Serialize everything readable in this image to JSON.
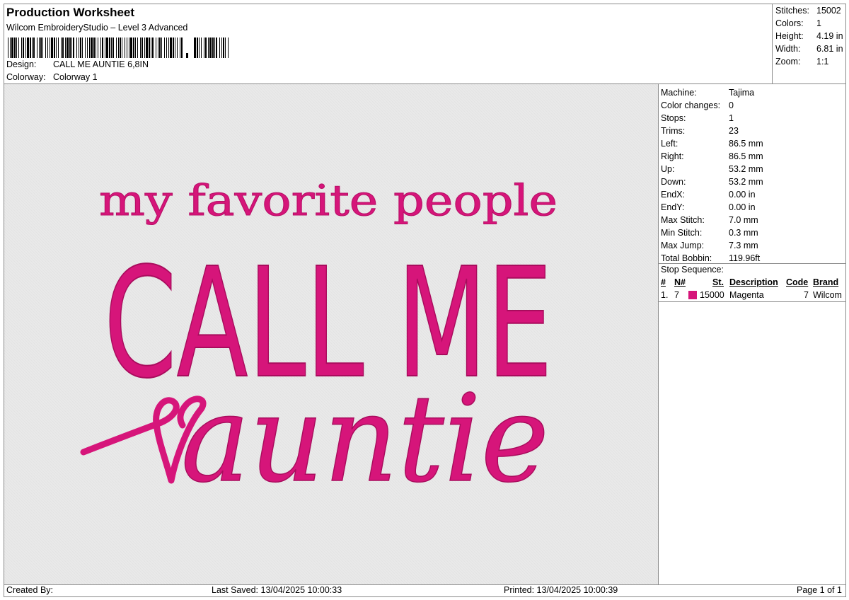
{
  "header": {
    "title": "Production Worksheet",
    "software": "Wilcom EmbroideryStudio – Level 3 Advanced",
    "design_label": "Design:",
    "design_value": "CALL ME AUNTIE 6,8IN",
    "colorway_label": "Colorway:",
    "colorway_value": "Colorway 1"
  },
  "summary": [
    {
      "label": "Stitches:",
      "value": "15002"
    },
    {
      "label": "Colors:",
      "value": "1"
    },
    {
      "label": "Height:",
      "value": "4.19 in"
    },
    {
      "label": "Width:",
      "value": "6.81 in"
    },
    {
      "label": "Zoom:",
      "value": "1:1"
    }
  ],
  "machine": [
    {
      "label": "Machine:",
      "value": "Tajima"
    },
    {
      "label": "Color changes:",
      "value": "0"
    },
    {
      "label": "Stops:",
      "value": "1"
    },
    {
      "label": "Trims:",
      "value": "23"
    },
    {
      "label": "Left:",
      "value": "86.5 mm"
    },
    {
      "label": "Right:",
      "value": "86.5 mm"
    },
    {
      "label": "Up:",
      "value": "53.2 mm"
    },
    {
      "label": "Down:",
      "value": "53.2 mm"
    },
    {
      "label": "EndX:",
      "value": "0.00 in"
    },
    {
      "label": "EndY:",
      "value": "0.00 in"
    },
    {
      "label": "Max Stitch:",
      "value": "7.0 mm"
    },
    {
      "label": "Min Stitch:",
      "value": "0.3 mm"
    },
    {
      "label": "Max Jump:",
      "value": "7.3 mm"
    },
    {
      "label": "Total Bobbin:",
      "value": "119.96ft"
    }
  ],
  "stop_sequence": {
    "title": "Stop Sequence:",
    "headers": {
      "num": "#",
      "n": "N#",
      "st": "St.",
      "description": "Description",
      "code": "Code",
      "brand": "Brand"
    },
    "rows": [
      {
        "num": "1.",
        "n": "7",
        "st": "15000",
        "description": "Magenta",
        "code": "7",
        "brand": "Wilcom",
        "color": "#d6157a"
      }
    ]
  },
  "design_preview": {
    "line1": "my favorite people",
    "line2": "CALL ME",
    "line3": "auntie",
    "thread_color": "#d6157a",
    "thread_light": "#e84a9c",
    "background": "#e8e8e8"
  },
  "footer": {
    "created_by": "Created By:",
    "last_saved": "Last Saved: 13/04/2025 10:00:33",
    "printed": "Printed: 13/04/2025 10:00:39",
    "page": "Page 1 of 1"
  }
}
